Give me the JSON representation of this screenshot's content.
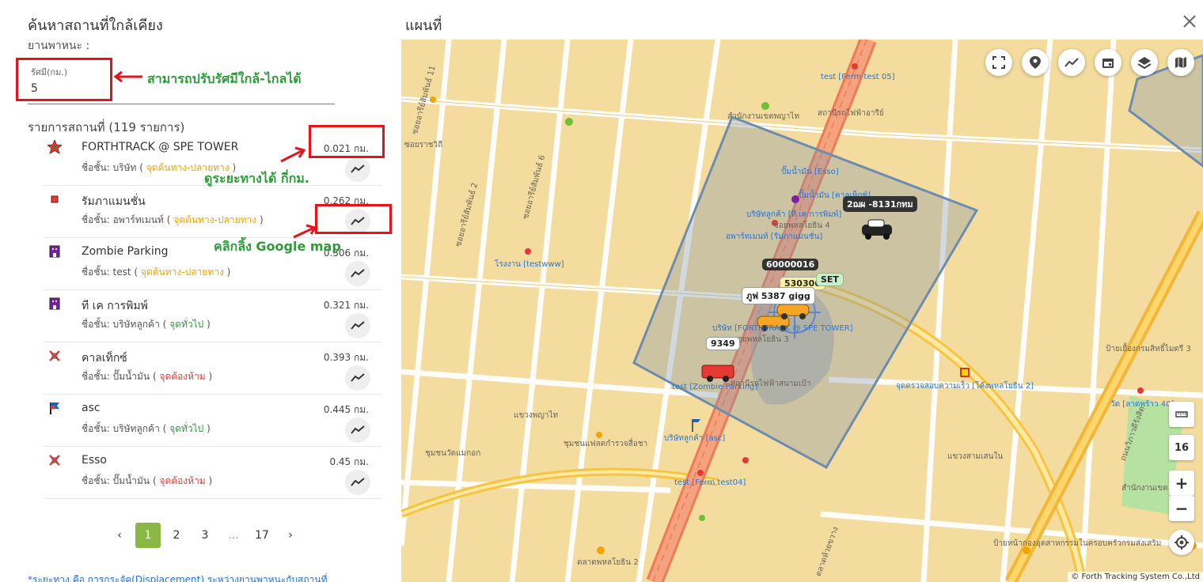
{
  "panel": {
    "title": "ค้นหาสถานที่ใกล้เคียง",
    "vehicle_label": "ยานพาหนะ :",
    "radius_label": "รัศมี(กม.)",
    "radius_value": "5",
    "list_header": "รายการสถานที่ (119 รายการ)",
    "footnote": "*ระยะทาง คือ การกระจัด(Displacement) ระหว่างยานพาหนะกับสถานที่"
  },
  "annotations": {
    "radius_note": "สามารถปรับรัศมีใกล้-ไกลได้",
    "distance_note": "ดูระยะทางได้ กี่กม.",
    "google_note": "คลิกลิ้ง Google map"
  },
  "places": [
    {
      "name": "FORTHTRACK @ SPE TOWER",
      "distance": "0.021 กม.",
      "type_prefix": "ชื่อชั้น: บริษัท (",
      "tag": "จุดต้นทาง-ปลายทาง",
      "suffix": ")",
      "icon": "red-star-icon",
      "tag_color": "orange"
    },
    {
      "name": "รัมภาแมนชั่น",
      "distance": "0.262 กม.",
      "type_prefix": "ชื่อชั้น: อพาร์ทเมนท์ (",
      "tag": "จุดต้นทาง-ปลายทาง",
      "suffix": ")",
      "icon": "red-square-icon",
      "tag_color": "orange"
    },
    {
      "name": "Zombie Parking",
      "distance": "0.306 กม.",
      "type_prefix": "ชื่อชั้น: test (",
      "tag": "จุดต้นทาง-ปลายทาง",
      "suffix": ")",
      "icon": "purple-building-icon",
      "tag_color": "orange"
    },
    {
      "name": "ที เค การพิมพ์",
      "distance": "0.321 กม.",
      "type_prefix": "ชื่อชั้น: บริษัทลูกค้า (",
      "tag": "จุดทั่วไป",
      "suffix": ")",
      "icon": "purple-building-icon",
      "tag_color": "green"
    },
    {
      "name": "คาลเท็กซ์",
      "distance": "0.393 กม.",
      "type_prefix": "ชื่อชั้น: ปั๊มน้ำมัน (",
      "tag": "จุดต้องห้าม",
      "suffix": ")",
      "icon": "crossed-tools-icon",
      "tag_color": "red"
    },
    {
      "name": "asc",
      "distance": "0.445 กม.",
      "type_prefix": "ชื่อชั้น: บริษัทลูกค้า (",
      "tag": "จุดทั่วไป",
      "suffix": ")",
      "icon": "flag-icon",
      "tag_color": "green"
    },
    {
      "name": "Esso",
      "distance": "0.45 กม.",
      "type_prefix": "ชื่อชั้น: ปั๊มน้ำมัน (",
      "tag": "จุดต้องห้าม",
      "suffix": ")",
      "icon": "crossed-tools-icon",
      "tag_color": "red"
    }
  ],
  "pagination": {
    "prev": "‹",
    "pages": [
      "1",
      "2",
      "3",
      "...",
      "17"
    ],
    "next": "›",
    "active": "1"
  },
  "map": {
    "title": "แผนที่",
    "zoom_level": "16",
    "copyright": "© Forth Tracking System Co.,Ltd",
    "zoom_in": "+",
    "zoom_out": "−",
    "vehicle_tags": [
      "2ฌผ -8131กทม",
      "60000016",
      "530306",
      "SET",
      "ภูฟ 5387 gigg",
      "9349"
    ],
    "place_labels": [
      "test [Ferm test 05]",
      "ปั๊มน้ำมัน [Esso]",
      "ปั๊มน้ำมัน [คาลเท็กซ์]",
      "บริษัทลูกค้า [ที เค การพิมพ์]",
      "อพาร์ทเมนท์ [รัมภาแมนชั่น]",
      "โรงงาน [testwww]",
      "บริษัท [FORTHTRACK @ SPE TOWER]",
      "test [Zombie Parking]",
      "บริษัทลูกค้า [asc]",
      "test [Ferm test04]",
      "จุดตรวจสอบความเร็ว [โค้งพหลโยธิน 2]",
      "วัด [ลาดพร้าว 40]"
    ],
    "street_labels": [
      "สำนักงานเขตพญาไท",
      "สถานีรถไฟฟ้าอารีย์",
      "ซอยพหลโยธิน 4",
      "ซอยพหลโยธิน 3",
      "สถานีรถไฟฟ้าสนามเป้า",
      "แขวงพญาไท",
      "ชุมชนวัดแมกอก",
      "ชุมชนแฟลตกำรวจสื่อชา",
      "แขวงสามเสนใน",
      "ป้ายเยื้องกรมสิทธิ์ไมตรี 3",
      "ป้ายหน้ากองอุตสาหกรรมในครอบครัวกรมส่งเสริม",
      "ตลาดพหลโยธิน 2",
      "ถนนวิภาวดีรังสิต",
      "ซอยอารีย์สัมพันธ์ 6",
      "ซอยอารีย์สัมพันธ์ 2",
      "ซอยอารีย์สัมพันธ์ 11",
      "ตลาดห้วยขวาง",
      "ซอยราชวิถี",
      "สำนักงานเขต"
    ]
  }
}
